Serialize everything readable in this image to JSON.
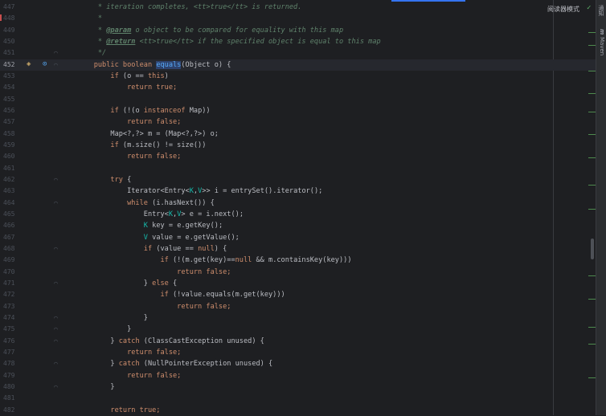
{
  "reader_mode_label": "阅读器模式",
  "right_tabs": [
    "通知",
    "m",
    "Maven"
  ],
  "lines": [
    {
      "n": "447",
      "parts": [
        {
          "t": "     * iteration completes, <tt>true</tt> is returned.",
          "c": "cm"
        }
      ]
    },
    {
      "n": "448",
      "parts": [
        {
          "t": "     *",
          "c": "cm"
        }
      ]
    },
    {
      "n": "449",
      "parts": [
        {
          "t": "     * ",
          "c": "cm"
        },
        {
          "t": "@param",
          "c": "tag"
        },
        {
          "t": " o object to be compared for equality with this map",
          "c": "cm"
        }
      ]
    },
    {
      "n": "450",
      "parts": [
        {
          "t": "     * ",
          "c": "cm"
        },
        {
          "t": "@return",
          "c": "tag"
        },
        {
          "t": " <tt>true</tt> if the specified object is equal to this map",
          "c": "cm"
        }
      ]
    },
    {
      "n": "451",
      "parts": [
        {
          "t": "     */",
          "c": "cm"
        }
      ]
    },
    {
      "n": "452",
      "current": true,
      "parts": [
        {
          "t": "    public boolean ",
          "c": "kw"
        },
        {
          "t": "equals",
          "c": "fn hl"
        },
        {
          "t": "(Object o) {",
          "c": ""
        }
      ]
    },
    {
      "n": "453",
      "parts": [
        {
          "t": "        if",
          "c": "kw"
        },
        {
          "t": " (o == ",
          "c": ""
        },
        {
          "t": "this",
          "c": "kw"
        },
        {
          "t": ")",
          "c": ""
        }
      ]
    },
    {
      "n": "454",
      "parts": [
        {
          "t": "            return true;",
          "c": "kw"
        }
      ]
    },
    {
      "n": "455",
      "parts": []
    },
    {
      "n": "456",
      "parts": [
        {
          "t": "        if",
          "c": "kw"
        },
        {
          "t": " (!(o ",
          "c": ""
        },
        {
          "t": "instanceof",
          "c": "kw"
        },
        {
          "t": " Map))",
          "c": ""
        }
      ]
    },
    {
      "n": "457",
      "parts": [
        {
          "t": "            return false;",
          "c": "kw"
        }
      ]
    },
    {
      "n": "458",
      "parts": [
        {
          "t": "        Map<?,?> m = (Map<?,?>) o;",
          "c": ""
        }
      ]
    },
    {
      "n": "459",
      "parts": [
        {
          "t": "        if",
          "c": "kw"
        },
        {
          "t": " (m.size() != size())",
          "c": ""
        }
      ]
    },
    {
      "n": "460",
      "parts": [
        {
          "t": "            return false;",
          "c": "kw"
        }
      ]
    },
    {
      "n": "461",
      "parts": []
    },
    {
      "n": "462",
      "parts": [
        {
          "t": "        try",
          "c": "kw"
        },
        {
          "t": " {",
          "c": ""
        }
      ]
    },
    {
      "n": "463",
      "parts": [
        {
          "t": "            Iterator<Entry<",
          "c": ""
        },
        {
          "t": "K",
          "c": "tp"
        },
        {
          "t": ",",
          "c": ""
        },
        {
          "t": "V",
          "c": "tp"
        },
        {
          "t": ">> i = entrySet().iterator();",
          "c": ""
        }
      ]
    },
    {
      "n": "464",
      "parts": [
        {
          "t": "            while",
          "c": "kw"
        },
        {
          "t": " (i.hasNext()) {",
          "c": ""
        }
      ]
    },
    {
      "n": "465",
      "parts": [
        {
          "t": "                Entry<",
          "c": ""
        },
        {
          "t": "K",
          "c": "tp"
        },
        {
          "t": ",",
          "c": ""
        },
        {
          "t": "V",
          "c": "tp"
        },
        {
          "t": "> e = i.next();",
          "c": ""
        }
      ]
    },
    {
      "n": "466",
      "parts": [
        {
          "t": "                ",
          "c": ""
        },
        {
          "t": "K",
          "c": "tp"
        },
        {
          "t": " key = e.getKey();",
          "c": ""
        }
      ]
    },
    {
      "n": "467",
      "parts": [
        {
          "t": "                ",
          "c": ""
        },
        {
          "t": "V",
          "c": "tp"
        },
        {
          "t": " value = e.getValue();",
          "c": ""
        }
      ]
    },
    {
      "n": "468",
      "parts": [
        {
          "t": "                if",
          "c": "kw"
        },
        {
          "t": " (value == ",
          "c": ""
        },
        {
          "t": "null",
          "c": "kw"
        },
        {
          "t": ") {",
          "c": ""
        }
      ]
    },
    {
      "n": "469",
      "parts": [
        {
          "t": "                    if",
          "c": "kw"
        },
        {
          "t": " (!(m.get(key)==",
          "c": ""
        },
        {
          "t": "null",
          "c": "kw"
        },
        {
          "t": " && m.containsKey(key)))",
          "c": ""
        }
      ]
    },
    {
      "n": "470",
      "parts": [
        {
          "t": "                        return false;",
          "c": "kw"
        }
      ]
    },
    {
      "n": "471",
      "parts": [
        {
          "t": "                } ",
          "c": ""
        },
        {
          "t": "else",
          "c": "kw"
        },
        {
          "t": " {",
          "c": ""
        }
      ]
    },
    {
      "n": "472",
      "parts": [
        {
          "t": "                    if",
          "c": "kw"
        },
        {
          "t": " (!value.equals(m.get(key)))",
          "c": ""
        }
      ]
    },
    {
      "n": "473",
      "parts": [
        {
          "t": "                        return false;",
          "c": "kw"
        }
      ]
    },
    {
      "n": "474",
      "parts": [
        {
          "t": "                }",
          "c": ""
        }
      ]
    },
    {
      "n": "475",
      "parts": [
        {
          "t": "            }",
          "c": ""
        }
      ]
    },
    {
      "n": "476",
      "parts": [
        {
          "t": "        } ",
          "c": ""
        },
        {
          "t": "catch",
          "c": "kw"
        },
        {
          "t": " (ClassCastException unused) {",
          "c": ""
        }
      ]
    },
    {
      "n": "477",
      "parts": [
        {
          "t": "            return false;",
          "c": "kw"
        }
      ]
    },
    {
      "n": "478",
      "parts": [
        {
          "t": "        } ",
          "c": ""
        },
        {
          "t": "catch",
          "c": "kw"
        },
        {
          "t": " (NullPointerException unused) {",
          "c": ""
        }
      ]
    },
    {
      "n": "479",
      "parts": [
        {
          "t": "            return false;",
          "c": "kw"
        }
      ]
    },
    {
      "n": "480",
      "parts": [
        {
          "t": "        }",
          "c": ""
        }
      ]
    },
    {
      "n": "481",
      "parts": []
    },
    {
      "n": "482",
      "parts": [
        {
          "t": "        return true;",
          "c": "kw"
        }
      ]
    }
  ]
}
